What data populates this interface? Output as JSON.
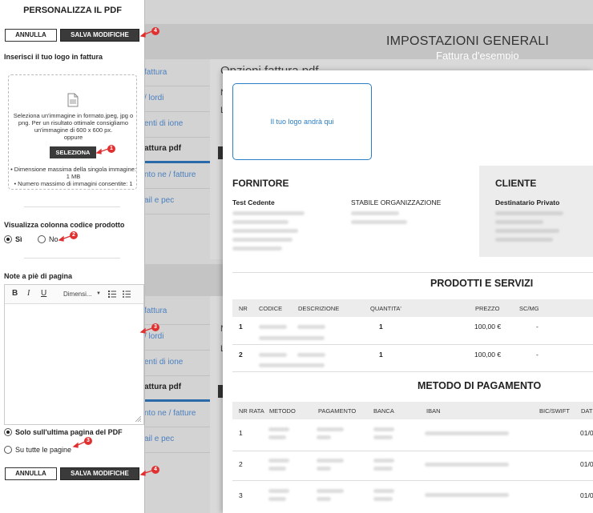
{
  "panel": {
    "title": "PERSONALIZZA IL PDF",
    "cancel_label": "ANNULLA",
    "save_label": "SALVA MODIFICHE",
    "logo_section_title": "Inserisci il tuo logo in fattura",
    "dropzone_text_1": "Seleziona un'immagine in formato.jpeg, jpg o png. Per un risultato ottimale consigliamo un'immagine di 600 x 600 px.",
    "dropzone_text_2": "oppure",
    "select_label": "SELEZIONA",
    "dropzone_limits_1": "• Dimensione massima della singola immagine: 1 MB",
    "dropzone_limits_2": "• Numero massimo di immagini consentite: 1",
    "product_code_title": "Visualizza colonna codice prodotto",
    "yes_label": "Sì",
    "no_label": "No",
    "footnotes_title": "Note a piè di pagina",
    "editor_font_select": "Dimensi...",
    "last_page_label": "Solo sull'ultima pagina del PDF",
    "all_pages_label": "Su tutte le pagine",
    "selected_product_code": "Sì",
    "selected_footnote_option": "Solo sull'ultima pagina del PDF"
  },
  "markers": [
    "4",
    "1",
    "2",
    "3",
    "3",
    "4"
  ],
  "background": {
    "title": "IMPOSTAZIONI GENERALI",
    "subtitle": "Fattura d'esempio",
    "panel_title": "Opzioni fattura pdf",
    "side_top": [
      "fattura",
      "/ lordi",
      "enti di ione",
      "attura pdf",
      "nto ne / fatture",
      "ail e pec"
    ],
    "side_bottom": [
      "fattura",
      "/ lordi",
      "enti di ione",
      "attura pdf",
      "nto ne / fatture",
      "ail e pec"
    ]
  },
  "preview": {
    "logo_placeholder": "Il tuo logo andrà qui",
    "supplier_title": "FORNITORE",
    "supplier_name": "Test Cedente",
    "stable_org": "STABILE ORGANIZZAZIONE",
    "client_title": "CLIENTE",
    "client_name": "Destinatario Privato",
    "products_title": "PRODOTTI E SERVIZI",
    "products_headers": [
      "NR",
      "CODICE",
      "DESCRIZIONE",
      "QUANTITA'",
      "PREZZO",
      "SC/MG"
    ],
    "products_rows": [
      {
        "nr": "1",
        "qty": "1",
        "price": "100,00 €",
        "disc": "-"
      },
      {
        "nr": "2",
        "qty": "1",
        "price": "100,00 €",
        "disc": "-"
      }
    ],
    "payment_title": "METODO DI PAGAMENTO",
    "payment_headers": [
      "NR RATA",
      "METODO",
      "PAGAMENTO",
      "BANCA",
      "IBAN",
      "BIC/SWIFT",
      "DAT"
    ],
    "payment_rows": [
      {
        "nr": "1",
        "date": "01/0"
      },
      {
        "nr": "2",
        "date": "01/0"
      },
      {
        "nr": "3",
        "date": "01/0"
      }
    ]
  }
}
